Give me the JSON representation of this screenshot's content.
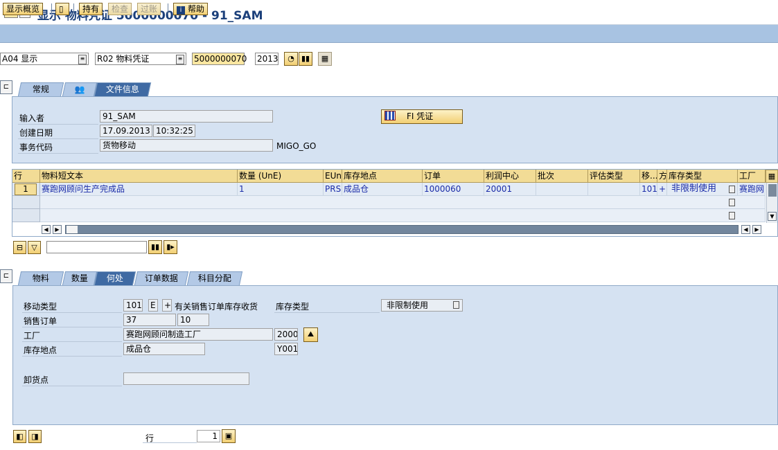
{
  "window": {
    "title": "显示 物料凭证 5000000070 - 91_SAM"
  },
  "toolbar": {
    "overview": "显示概览",
    "hold": "持有",
    "check": "检查",
    "post": "过账",
    "help": "帮助"
  },
  "header": {
    "action": "A04 显示",
    "reference": "R02 物料凭证",
    "doc_number": "5000000070",
    "year": "2013"
  },
  "header_tabs": {
    "general": "常规",
    "doc_info": "文件信息"
  },
  "doc_info": {
    "entered_by_label": "输入者",
    "entered_by": "91_SAM",
    "created_label": "创建日期",
    "created_date": "17.09.2013",
    "created_time": "10:32:25",
    "tcode_label": "事务代码",
    "tcode": "货物移动",
    "tcode_value": "MIGO_GO",
    "fi_button": "FI 凭证"
  },
  "grid": {
    "headers": [
      "行",
      "物料短文本",
      "数量 (UnE)",
      "EUn",
      "库存地点",
      "订单",
      "利润中心",
      "批次",
      "评估类型",
      "移...",
      "方",
      "库存类型",
      "工厂"
    ],
    "row1": {
      "line": "1",
      "material_text": "赛跑网顾问生产完成品",
      "qty": "1",
      "unit": "PRS",
      "sloc": "成品仓",
      "order": "1000060",
      "profit_center": "20001",
      "mvt": "101",
      "dir": "+",
      "stock_type": "非限制使用",
      "plant": "赛跑网"
    }
  },
  "detail_tabs": {
    "material": "物料",
    "quantity": "数量",
    "where": "何处",
    "order_data": "订单数据",
    "account": "科目分配"
  },
  "where": {
    "mvt_label": "移动类型",
    "mvt": "101",
    "mvt_flag": "E",
    "mvt_sign": "+",
    "mvt_text": "有关销售订单库存收货",
    "stock_type_label": "库存类型",
    "stock_type": "非限制使用",
    "so_label": "销售订单",
    "so": "37",
    "so_item": "10",
    "plant_label": "工厂",
    "plant_name": "赛跑网顾问制造工厂",
    "plant_code": "2000",
    "sloc_label": "库存地点",
    "sloc_name": "成品仓",
    "sloc_code": "Y001",
    "unload_label": "卸货点"
  },
  "footer": {
    "line_label": "行",
    "line_value": "1"
  }
}
